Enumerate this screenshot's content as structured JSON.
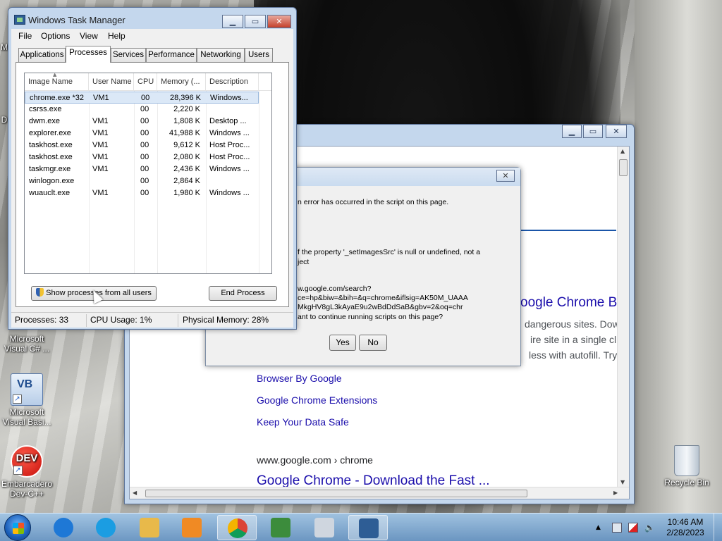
{
  "desktop": {
    "icons": [
      {
        "label": "Microsoft Visual C# ...",
        "line1": "Microsoft",
        "line2": "Visual C# ..."
      },
      {
        "label": "Microsoft Visual Basi...",
        "line1": "Microsoft",
        "line2": "Visual Basi..."
      },
      {
        "label": "Embarcadero Dev-C++",
        "line1": "Embarcadero",
        "line2": "Dev-C++",
        "badge": "DEV",
        "badge2": "++"
      },
      {
        "label": "Recycle Bin",
        "line1": "Recycle Bin"
      }
    ],
    "partial_labels": [
      "M",
      "D"
    ]
  },
  "taskmgr": {
    "title": "Windows Task Manager",
    "menu": [
      "File",
      "Options",
      "View",
      "Help"
    ],
    "tabs": [
      "Applications",
      "Processes",
      "Services",
      "Performance",
      "Networking",
      "Users"
    ],
    "active_tab": "Processes",
    "columns": [
      "Image Name",
      "User Name",
      "CPU",
      "Memory (...",
      "Description"
    ],
    "rows": [
      {
        "name": "chrome.exe *32",
        "user": "VM1",
        "cpu": "00",
        "mem": "28,396 K",
        "desc": "Windows...",
        "selected": true
      },
      {
        "name": "csrss.exe",
        "user": "",
        "cpu": "00",
        "mem": "2,220 K",
        "desc": ""
      },
      {
        "name": "dwm.exe",
        "user": "VM1",
        "cpu": "00",
        "mem": "1,808 K",
        "desc": "Desktop ..."
      },
      {
        "name": "explorer.exe",
        "user": "VM1",
        "cpu": "00",
        "mem": "41,988 K",
        "desc": "Windows ..."
      },
      {
        "name": "taskhost.exe",
        "user": "VM1",
        "cpu": "00",
        "mem": "9,612 K",
        "desc": "Host Proc..."
      },
      {
        "name": "taskhost.exe",
        "user": "VM1",
        "cpu": "00",
        "mem": "2,080 K",
        "desc": "Host Proc..."
      },
      {
        "name": "taskmgr.exe",
        "user": "VM1",
        "cpu": "00",
        "mem": "2,436 K",
        "desc": "Windows ..."
      },
      {
        "name": "winlogon.exe",
        "user": "",
        "cpu": "00",
        "mem": "2,864 K",
        "desc": ""
      },
      {
        "name": "wuauclt.exe",
        "user": "VM1",
        "cpu": "00",
        "mem": "1,980 K",
        "desc": "Windows ..."
      }
    ],
    "show_all_label": "Show processes from all users",
    "end_process_label": "End Process",
    "status": {
      "processes": "Processes: 33",
      "cpu": "CPU Usage: 1%",
      "memory": "Physical Memory: 28%"
    }
  },
  "browser": {
    "heading_partial": "oogle Chrome B",
    "snippet_lines": [
      "dangerous sites. Dowr",
      "ire site in a single click",
      "less with autofill. Try D"
    ],
    "links": [
      "Browser By Google",
      "Google Chrome Extensions",
      "Keep Your Data Safe"
    ],
    "cite": "www.google.com › chrome",
    "result_title": "Google Chrome - Download the Fast ..."
  },
  "dialog": {
    "line1": "n error has occurred in the script on this page.",
    "line2": "f the property '_setImagesSrc' is null or undefined, not a",
    "line3": "ject",
    "line4": "w.google.com/search?",
    "line5": "ce=hp&biw=&bih=&q=chrome&iflsig=AK50M_UAAA",
    "line6": "MkgHV8gL3kAyaE9u2wBdDdSaB&gbv=2&oq=chr",
    "line7": "ant to continue running scripts on this page?",
    "yes_label": "Yes",
    "no_label": "No"
  },
  "taskbar": {
    "clock_time": "10:46 AM",
    "clock_date": "2/28/2023",
    "apps": [
      {
        "name": "internet-explorer-icon",
        "color": "#1e78d6"
      },
      {
        "name": "edge-icon",
        "color": "#1b9de2"
      },
      {
        "name": "file-explorer-icon",
        "color": "#e8b94a"
      },
      {
        "name": "media-player-icon",
        "color": "#f08a24"
      },
      {
        "name": "chrome-icon",
        "color": "#db4437"
      },
      {
        "name": "visual-csharp-icon",
        "color": "#3c8c3c"
      },
      {
        "name": "window-app-icon",
        "color": "#cfd6df"
      },
      {
        "name": "task-manager-icon",
        "color": "#2e5d95"
      }
    ]
  }
}
